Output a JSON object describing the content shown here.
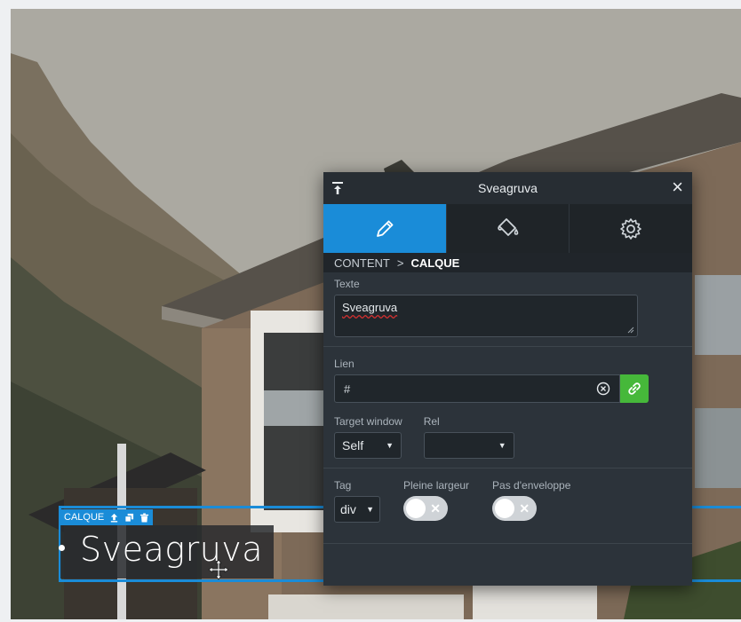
{
  "panel": {
    "title": "Sveagruva",
    "close_label": "×",
    "tabs": [
      {
        "icon": "pencil-icon",
        "active": true
      },
      {
        "icon": "paint-bucket-icon",
        "active": false
      },
      {
        "icon": "gear-icon",
        "active": false
      }
    ],
    "breadcrumb": {
      "parent": "CONTENT",
      "separator": ">",
      "current": "CALQUE"
    },
    "texte": {
      "label": "Texte",
      "value": "Sveagruva"
    },
    "lien": {
      "label": "Lien",
      "value": "#"
    },
    "target_window": {
      "label": "Target window",
      "value": "Self"
    },
    "rel": {
      "label": "Rel",
      "value": ""
    },
    "tag": {
      "label": "Tag",
      "value": "div"
    },
    "pleine_largeur": {
      "label": "Pleine largeur",
      "on": false
    },
    "pas_enveloppe": {
      "label": "Pas d'enveloppe",
      "on": false
    }
  },
  "selection": {
    "tag_label": "CALQUE",
    "text": "Sveagruva"
  },
  "colors": {
    "accent": "#1a8cd8",
    "link_button": "#46b83a",
    "panel_bg": "#2c333a"
  }
}
